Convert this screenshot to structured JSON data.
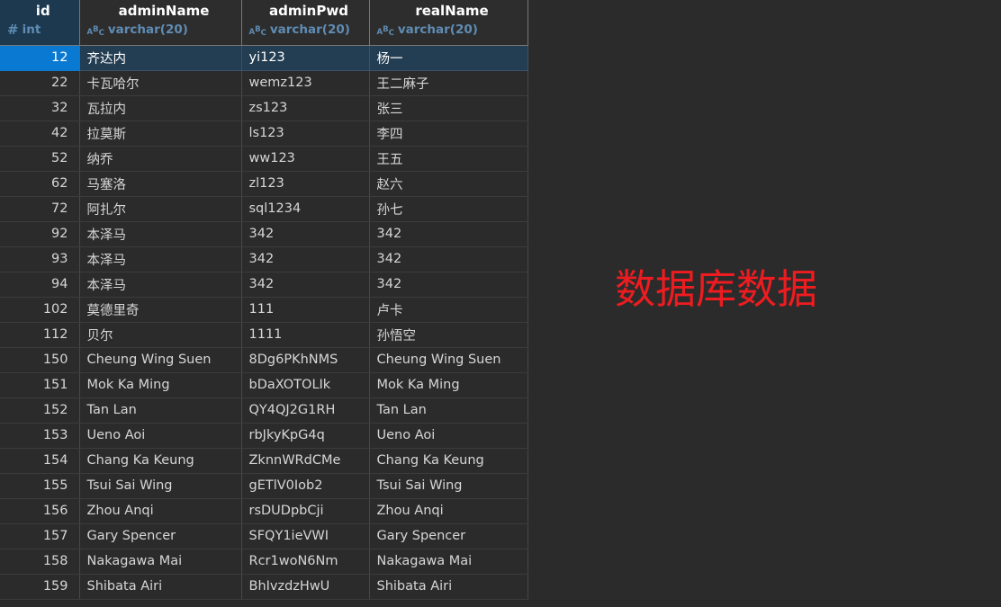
{
  "annotation": {
    "text": "数据库数据",
    "color": "#ee1c20"
  },
  "theme": {
    "background": "#2b2b2b",
    "row_background": "#2b2b2b",
    "header_background": "#2d2d2d",
    "header_id_background": "#1d394f",
    "selected_id_background": "#0a79d2",
    "selected_row_background": "#233d52",
    "grid_line": "#484848",
    "text": "#d6d6d6",
    "type_text": "#5f8cb4"
  },
  "table": {
    "columns": [
      {
        "name": "id",
        "type": "int",
        "icon": "hash-icon",
        "selected": true
      },
      {
        "name": "adminName",
        "type": "varchar(20)",
        "icon": "abc-type-icon",
        "selected": false
      },
      {
        "name": "adminPwd",
        "type": "varchar(20)",
        "icon": "abc-type-icon",
        "selected": false
      },
      {
        "name": "realName",
        "type": "varchar(20)",
        "icon": "abc-type-icon",
        "selected": false
      }
    ],
    "rows": [
      {
        "id": "12",
        "adminName": "齐达内",
        "adminPwd": "yi123",
        "realName": "杨一",
        "selected": true
      },
      {
        "id": "22",
        "adminName": "卡瓦哈尔",
        "adminPwd": "wemz123",
        "realName": "王二麻子",
        "selected": false
      },
      {
        "id": "32",
        "adminName": "瓦拉内",
        "adminPwd": "zs123",
        "realName": "张三",
        "selected": false
      },
      {
        "id": "42",
        "adminName": "拉莫斯",
        "adminPwd": "ls123",
        "realName": "李四",
        "selected": false
      },
      {
        "id": "52",
        "adminName": "纳乔",
        "adminPwd": "ww123",
        "realName": "王五",
        "selected": false
      },
      {
        "id": "62",
        "adminName": "马塞洛",
        "adminPwd": "zl123",
        "realName": "赵六",
        "selected": false
      },
      {
        "id": "72",
        "adminName": "阿扎尔",
        "adminPwd": "sql1234",
        "realName": "孙七",
        "selected": false
      },
      {
        "id": "92",
        "adminName": "本泽马",
        "adminPwd": "342",
        "realName": "342",
        "selected": false
      },
      {
        "id": "93",
        "adminName": "本泽马",
        "adminPwd": "342",
        "realName": "342",
        "selected": false
      },
      {
        "id": "94",
        "adminName": "本泽马",
        "adminPwd": "342",
        "realName": "342",
        "selected": false
      },
      {
        "id": "102",
        "adminName": "莫德里奇",
        "adminPwd": "111",
        "realName": "卢卡",
        "selected": false
      },
      {
        "id": "112",
        "adminName": "贝尔",
        "adminPwd": "1111",
        "realName": "孙悟空",
        "selected": false
      },
      {
        "id": "150",
        "adminName": "Cheung Wing Suen",
        "adminPwd": "8Dg6PKhNMS",
        "realName": "Cheung Wing Suen",
        "selected": false
      },
      {
        "id": "151",
        "adminName": "Mok Ka Ming",
        "adminPwd": "bDaXOTOLIk",
        "realName": "Mok Ka Ming",
        "selected": false
      },
      {
        "id": "152",
        "adminName": "Tan Lan",
        "adminPwd": "QY4QJ2G1RH",
        "realName": "Tan Lan",
        "selected": false
      },
      {
        "id": "153",
        "adminName": "Ueno Aoi",
        "adminPwd": "rbJkyKpG4q",
        "realName": "Ueno Aoi",
        "selected": false
      },
      {
        "id": "154",
        "adminName": "Chang Ka Keung",
        "adminPwd": "ZknnWRdCMe",
        "realName": "Chang Ka Keung",
        "selected": false
      },
      {
        "id": "155",
        "adminName": "Tsui Sai Wing",
        "adminPwd": "gETlV0Iob2",
        "realName": "Tsui Sai Wing",
        "selected": false
      },
      {
        "id": "156",
        "adminName": "Zhou Anqi",
        "adminPwd": "rsDUDpbCji",
        "realName": "Zhou Anqi",
        "selected": false
      },
      {
        "id": "157",
        "adminName": "Gary Spencer",
        "adminPwd": "SFQY1ieVWI",
        "realName": "Gary Spencer",
        "selected": false
      },
      {
        "id": "158",
        "adminName": "Nakagawa Mai",
        "adminPwd": "Rcr1woN6Nm",
        "realName": "Nakagawa Mai",
        "selected": false
      },
      {
        "id": "159",
        "adminName": "Shibata Airi",
        "adminPwd": "BhIvzdzHwU",
        "realName": "Shibata Airi",
        "selected": false
      }
    ]
  }
}
